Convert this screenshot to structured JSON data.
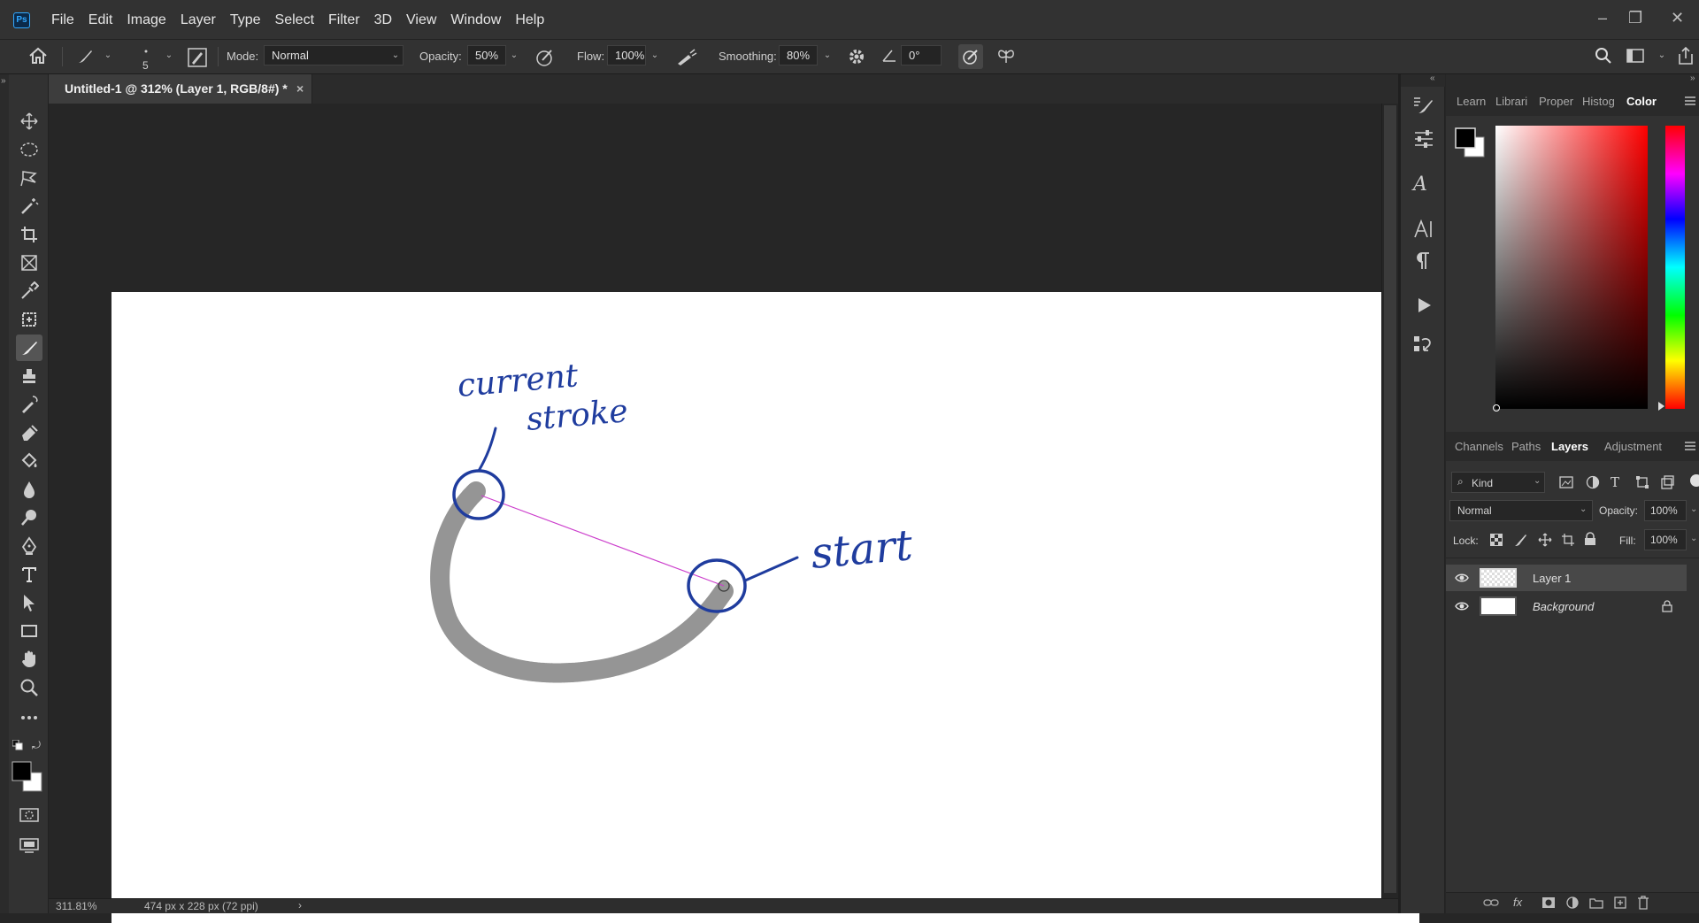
{
  "app": {
    "logo": "Ps"
  },
  "menu": [
    "File",
    "Edit",
    "Image",
    "Layer",
    "Type",
    "Select",
    "Filter",
    "3D",
    "View",
    "Window",
    "Help"
  ],
  "window_controls": {
    "minimize": "–",
    "restore": "❐",
    "close": "✕"
  },
  "options_bar": {
    "brush_size": "5",
    "mode_label": "Mode:",
    "mode_value": "Normal",
    "opacity_label": "Opacity:",
    "opacity_value": "50%",
    "flow_label": "Flow:",
    "flow_value": "100%",
    "smoothing_label": "Smoothing:",
    "smoothing_value": "80%",
    "angle_value": "0°"
  },
  "document": {
    "tab_title": "Untitled-1 @ 312% (Layer 1, RGB/8#) *",
    "close": "×"
  },
  "annotations": {
    "current_stroke_line1": "current",
    "current_stroke_line2": "stroke",
    "start": "start"
  },
  "status": {
    "zoom": "311.81%",
    "doc_size": "474 px x 228 px (72 ppi)",
    "arrow": "›"
  },
  "color_panel": {
    "tabs": [
      "Learn",
      "Librari",
      "Proper",
      "Histog",
      "Color"
    ],
    "active_tab": "Color",
    "hue_color": "#ff0000"
  },
  "layers_panel": {
    "tabs": [
      "Channels",
      "Paths",
      "Layers",
      "Adjustment"
    ],
    "active_tab": "Layers",
    "filter_kind": "Kind",
    "blend_mode": "Normal",
    "opacity_label": "Opacity:",
    "opacity_value": "100%",
    "lock_label": "Lock:",
    "fill_label": "Fill:",
    "fill_value": "100%",
    "layers": [
      {
        "name": "Layer 1",
        "selected": true,
        "locked": false
      },
      {
        "name": "Background",
        "selected": false,
        "locked": true
      }
    ]
  },
  "colors": {
    "annotation_blue": "#1f3c9e",
    "path_magenta": "#cc3fcc",
    "stroke_gray": "#8c8c8c"
  }
}
